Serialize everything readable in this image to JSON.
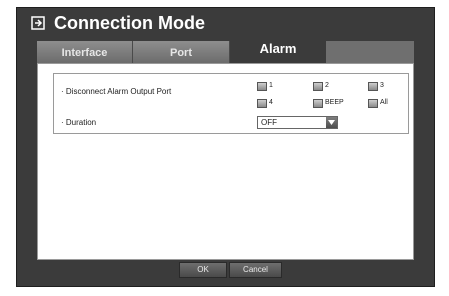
{
  "window": {
    "title": "Connection Mode",
    "title_icon": "connection-mode-icon"
  },
  "tabs": [
    {
      "label": "Interface",
      "active": false
    },
    {
      "label": "Port",
      "active": false
    },
    {
      "label": "Alarm",
      "active": true
    }
  ],
  "settings": {
    "disconnect_label": "· Disconnect Alarm Output Port",
    "ports": [
      {
        "label": "1",
        "checked": false
      },
      {
        "label": "2",
        "checked": false
      },
      {
        "label": "3",
        "checked": false
      },
      {
        "label": "4",
        "checked": false
      },
      {
        "label": "BEEP",
        "checked": false
      },
      {
        "label": "All",
        "checked": false
      }
    ],
    "duration_label": "· Duration",
    "duration_value": "OFF"
  },
  "buttons": {
    "ok": "OK",
    "cancel": "Cancel"
  },
  "colors": {
    "dialog_bg": "#3b3b3b",
    "tab_bg": "#8e8e8e",
    "content_bg": "#ffffff"
  }
}
